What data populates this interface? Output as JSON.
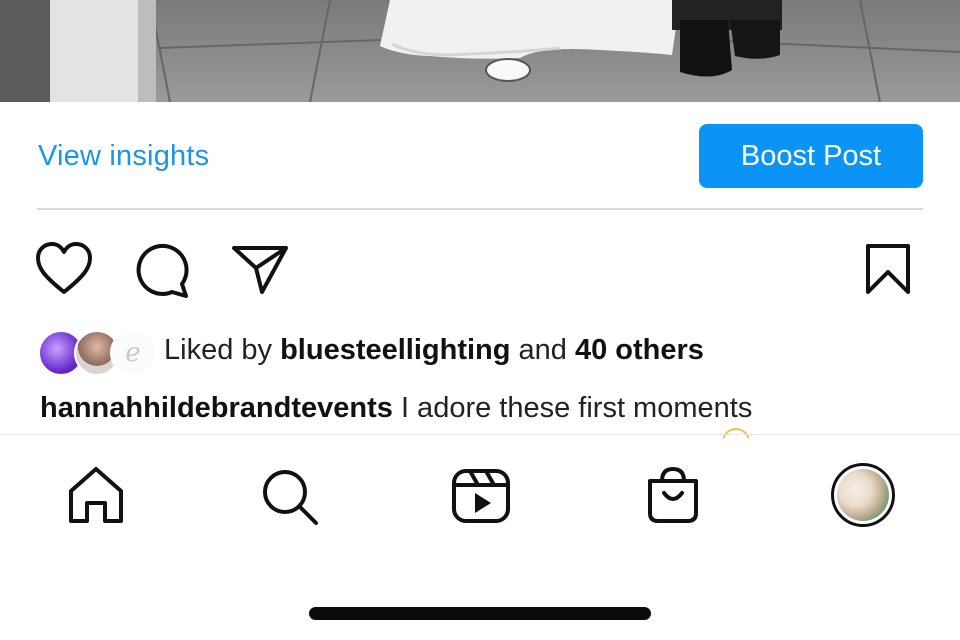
{
  "post_actions": {
    "view_insights_label": "View insights",
    "boost_post_label": "Boost Post"
  },
  "action_bar": {
    "icons": [
      "heart-icon",
      "comment-icon",
      "share-icon",
      "bookmark-icon"
    ]
  },
  "likes": {
    "prefix": "Liked by ",
    "user": "bluesteellighting",
    "connector": " and ",
    "others": "40 others"
  },
  "caption": {
    "username": "hannahhildebrandtevents",
    "text": " I adore these first moments"
  },
  "bottom_nav": {
    "items": [
      "home-icon",
      "search-icon",
      "reels-icon",
      "shop-icon",
      "profile-avatar"
    ]
  },
  "colors": {
    "link_blue": "#1a96e8",
    "button_blue": "#0a95f6",
    "divider": "#dbdbdb"
  }
}
